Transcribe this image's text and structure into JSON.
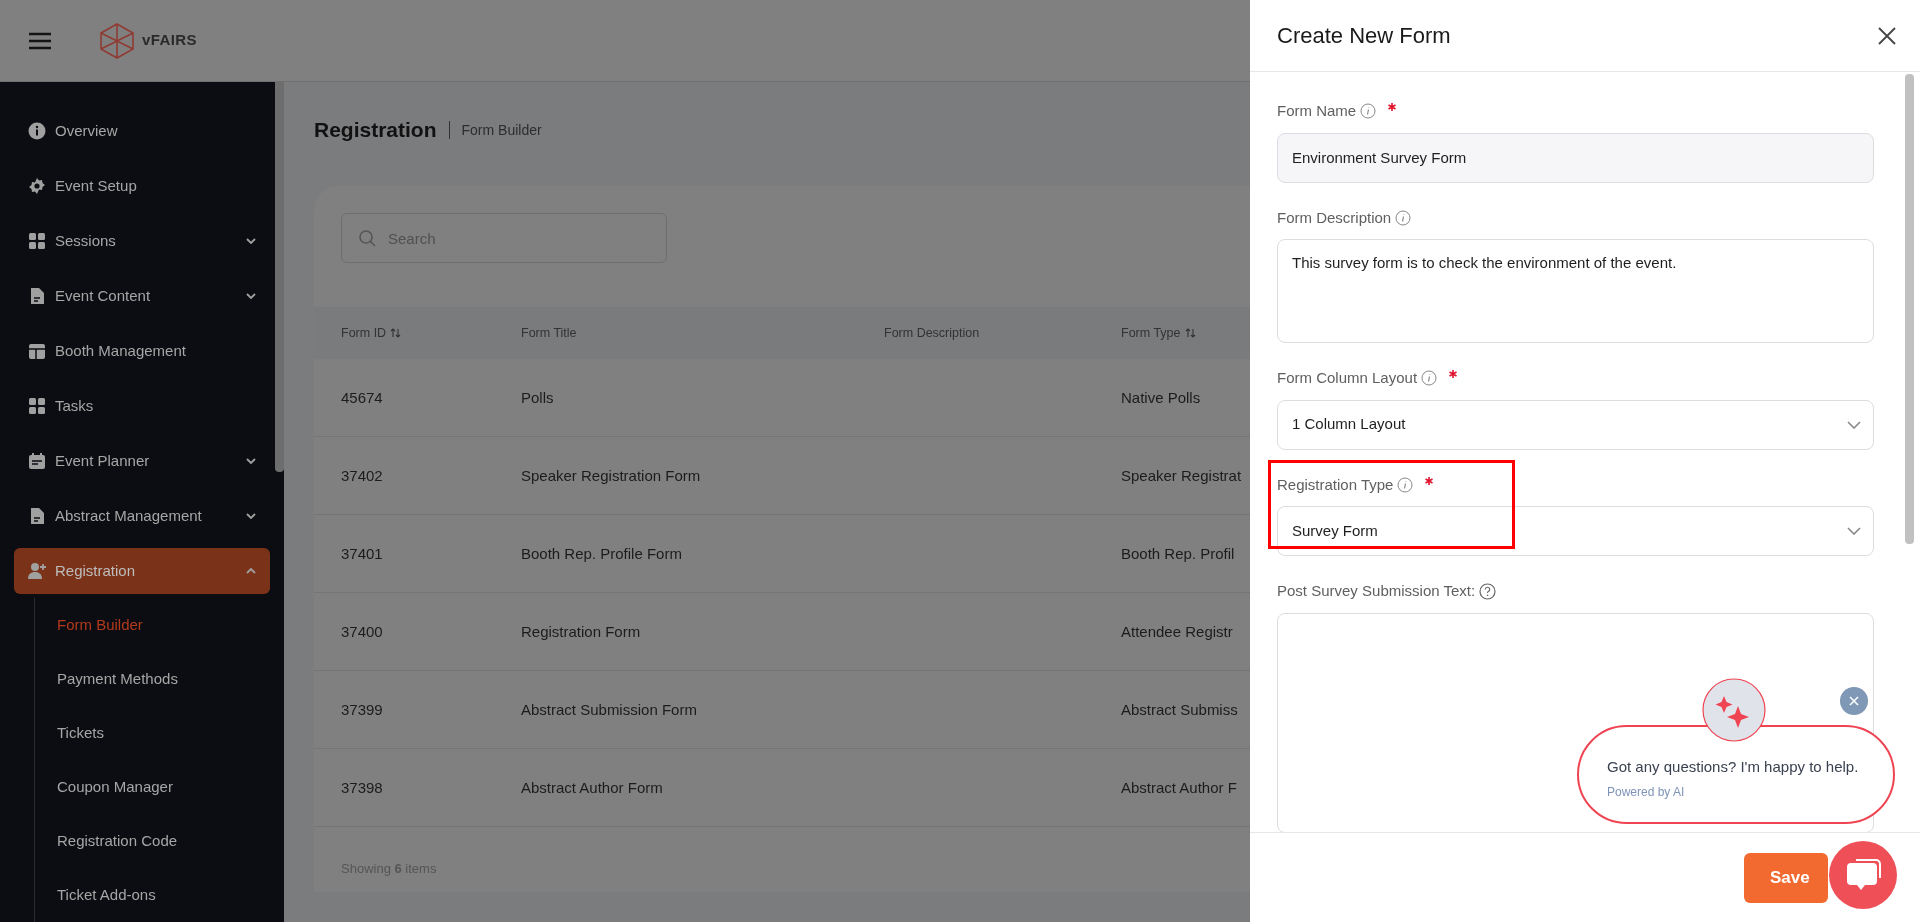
{
  "header": {
    "logo": "vFAIRS"
  },
  "sidebar": {
    "items": [
      {
        "label": "Overview",
        "selected": false
      },
      {
        "label": "Event Setup",
        "selected": false
      },
      {
        "label": "Sessions",
        "expanded": false,
        "selected": false
      },
      {
        "label": "Event Content",
        "expanded": false,
        "selected": false
      },
      {
        "label": "Booth Management",
        "selected": false
      },
      {
        "label": "Tasks",
        "selected": false
      },
      {
        "label": "Event Planner",
        "expanded": false,
        "selected": false
      },
      {
        "label": "Abstract Management",
        "expanded": false,
        "selected": false
      },
      {
        "label": "Registration",
        "expanded": true,
        "selected": true,
        "children": [
          {
            "label": "Form Builder",
            "selected": true
          },
          {
            "label": "Payment Methods",
            "selected": false
          },
          {
            "label": "Tickets",
            "selected": false
          },
          {
            "label": "Coupon Manager",
            "selected": false
          },
          {
            "label": "Registration Code",
            "selected": false
          },
          {
            "label": "Ticket Add-ons",
            "selected": false
          }
        ]
      }
    ]
  },
  "page": {
    "title": "Registration",
    "breadcrumb": "Form Builder"
  },
  "search": {
    "placeholder": "Search"
  },
  "table": {
    "columns": [
      {
        "label": "Form ID",
        "sortable": true
      },
      {
        "label": "Form Title"
      },
      {
        "label": "Form Description"
      },
      {
        "label": "Form Type",
        "sortable": true
      }
    ],
    "rows": [
      [
        "45674",
        "Polls",
        "",
        "Native Polls"
      ],
      [
        "37402",
        "Speaker Registration Form",
        "",
        "Speaker Registrat"
      ],
      [
        "37401",
        "Booth Rep. Profile Form",
        "",
        "Booth Rep. Profil"
      ],
      [
        "37400",
        "Registration Form",
        "",
        "Attendee Registr"
      ],
      [
        "37399",
        "Abstract Submission Form",
        "",
        "Abstract Submiss"
      ],
      [
        "37398",
        "Abstract Author Form",
        "",
        "Abstract Author F"
      ]
    ],
    "footer": "Showing **6** items"
  },
  "drawer": {
    "title": "Create New Form",
    "fields": [
      {
        "kind": "text",
        "label": "Form Name",
        "required": true,
        "highlighted": false,
        "value": "Environment Survey Form"
      },
      {
        "kind": "textarea",
        "label": "Form Description",
        "highlighted": false,
        "value": "This survey form is to check the environment of the event."
      },
      {
        "kind": "select",
        "label": "Form Column Layout",
        "required": true,
        "highlighted": false,
        "value": "1 Column Layout"
      },
      {
        "kind": "select",
        "label": "Registration Type",
        "required": true,
        "highlighted": true,
        "value": "Survey Form"
      },
      {
        "kind": "editor",
        "label": "Post Survey Submission Text:",
        "highlighted": false
      }
    ],
    "save_button": "Save"
  },
  "chat": {
    "message": "Got any questions? I'm happy to help.",
    "powered_by": "Powered by AI"
  }
}
